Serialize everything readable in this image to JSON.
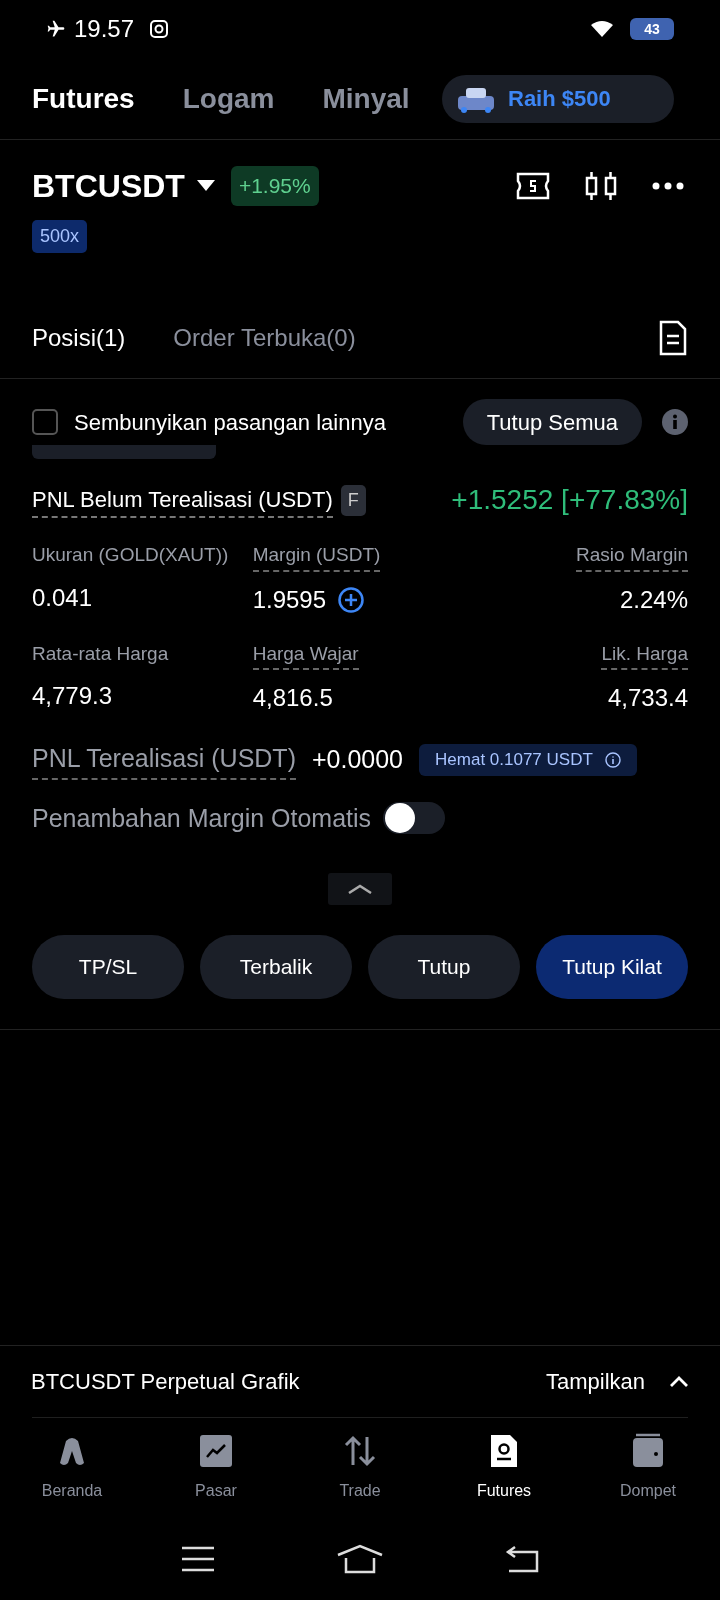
{
  "status_bar": {
    "time": "19.57",
    "battery": "43"
  },
  "top_tabs": [
    {
      "label": "Futures",
      "selected": true
    },
    {
      "label": "Logam",
      "selected": false
    },
    {
      "label": "Minyal",
      "selected": false
    }
  ],
  "promo": {
    "label": "Raih $500"
  },
  "symbol": {
    "name": "BTCUSDT",
    "change": "+1.95%",
    "leverage": "500x"
  },
  "position_tabs": [
    {
      "label": "Posisi(1)",
      "selected": true
    },
    {
      "label": "Order Terbuka(0)",
      "selected": false
    }
  ],
  "hide_pairs": {
    "label": "Sembunyikan pasangan lainnya",
    "checked": false
  },
  "close_all": "Tutup Semua",
  "unrealized": {
    "label": "PNL Belum Terealisasi (USDT)",
    "badge": "F",
    "value": "+1.5252 [+77.83%]"
  },
  "stats": [
    {
      "label": "Ukuran (GOLD(XAUT))",
      "value": "0.041",
      "dotted": false,
      "add": false
    },
    {
      "label": "Margin (USDT)",
      "value": "1.9595",
      "dotted": true,
      "add": true
    },
    {
      "label": "Rasio Margin",
      "value": "2.24%",
      "dotted": true,
      "add": false
    },
    {
      "label": "Rata-rata Harga",
      "value": "4,779.3",
      "dotted": false,
      "add": false
    },
    {
      "label": "Harga Wajar",
      "value": "4,816.5",
      "dotted": true,
      "add": false
    },
    {
      "label": "Lik. Harga",
      "value": "4,733.4",
      "dotted": true,
      "add": false
    }
  ],
  "realized": {
    "label": "PNL Terealisasi (USDT)",
    "value": "+0.0000",
    "saving": "Hemat 0.1077 USDT"
  },
  "auto_margin": {
    "label": "Penambahan Margin Otomatis",
    "on": false
  },
  "actions": [
    {
      "label": "TP/SL",
      "primary": false
    },
    {
      "label": "Terbalik",
      "primary": false
    },
    {
      "label": "Tutup",
      "primary": false
    },
    {
      "label": "Tutup Kilat",
      "primary": true
    }
  ],
  "chart_bar": {
    "title": "BTCUSDT Perpetual Grafik",
    "action": "Tampilkan"
  },
  "nav": [
    {
      "label": "Beranda",
      "kind": "home",
      "selected": false
    },
    {
      "label": "Pasar",
      "kind": "market",
      "selected": false
    },
    {
      "label": "Trade",
      "kind": "trade",
      "selected": false
    },
    {
      "label": "Futures",
      "kind": "futures",
      "selected": true
    },
    {
      "label": "Dompet",
      "kind": "wallet",
      "selected": false
    }
  ]
}
